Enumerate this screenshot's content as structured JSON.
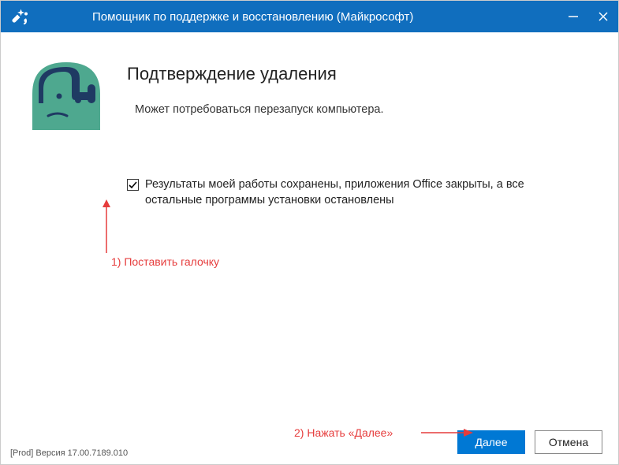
{
  "window": {
    "title": "Помощник по поддержке и восстановлению (Майкрософт)"
  },
  "main": {
    "heading": "Подтверждение удаления",
    "subtext": "Может потребоваться перезапуск компьютера.",
    "checkbox_label": "Результаты моей работы сохранены, приложения Office закрыты, а все остальные программы установки остановлены",
    "checkbox_checked": true
  },
  "footer": {
    "version": "[Prod] Версия 17.00.7189.010",
    "primary_label": "Далее",
    "secondary_label": "Отмена"
  },
  "annotations": {
    "step1": "1) Поставить галочку",
    "step2": "2) Нажать «Далее»"
  },
  "colors": {
    "titlebar": "#106ebe",
    "primary_button": "#0078d4",
    "annotation": "#e63c3c",
    "hero_bg": "#4ea88f",
    "hero_accent": "#1f3a63"
  }
}
